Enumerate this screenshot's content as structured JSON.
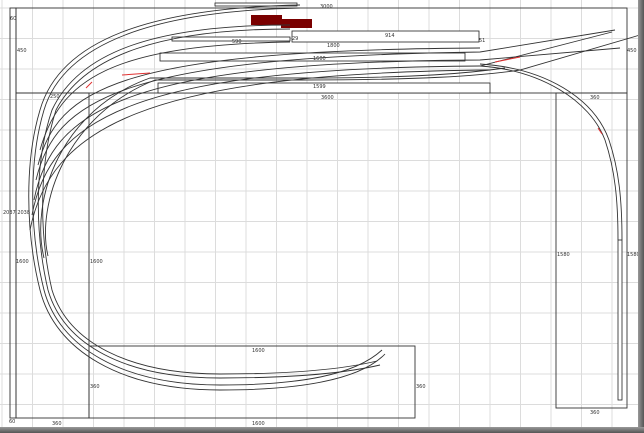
{
  "labels": {
    "left_strip_top": "60",
    "left_depth": "450",
    "top_length": "3000",
    "siding_590": "590",
    "siding_914": "914",
    "track_1800": "1800",
    "track_1600": "1600",
    "track_1599": "1599",
    "front_edge_3600": "3600",
    "right_corner_360": "360",
    "right_depth": "450",
    "left_inner_1600": "1600",
    "left_outer_1600": "1600",
    "left_marks": "2037 2038",
    "right_inner_1580": "1580",
    "right_outer_1580": "1580",
    "bottom_top_1600": "1600",
    "bottom_right_360": "360",
    "bottom_bottom_1600": "1600",
    "bottom_left_360": "360",
    "left_bottom_360": "360",
    "left_bottom_60": "60",
    "right_bottom_360": "360",
    "corner_250": "250",
    "mark_29": "29",
    "mark_51": "51"
  },
  "colors": {
    "building": "#7a0000",
    "grid": "#dcdcdc",
    "highlight": "#e03030"
  }
}
